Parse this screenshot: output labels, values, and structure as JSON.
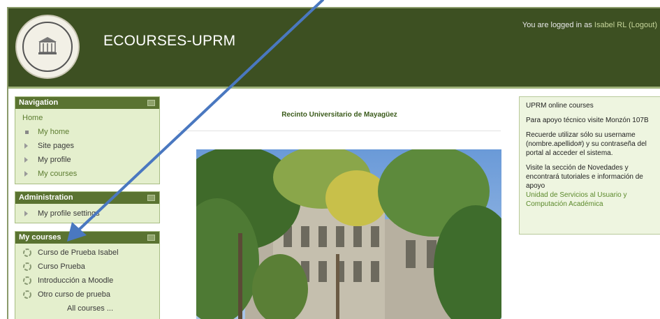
{
  "header": {
    "site_title": "ECOURSES-UPRM",
    "login_prefix": "You are logged in as",
    "user_name": "Isabel RL",
    "logout_label": "(Logout)"
  },
  "navigation": {
    "title": "Navigation",
    "home": "Home",
    "items": [
      "My home",
      "Site pages",
      "My profile",
      "My courses"
    ]
  },
  "administration": {
    "title": "Administration",
    "items": [
      "My profile settings"
    ]
  },
  "my_courses": {
    "title": "My courses",
    "courses": [
      "Curso de Prueba Isabel",
      "Curso Prueba",
      "Introducción a Moodle",
      "Otro curso de prueba"
    ],
    "all_courses": "All courses ..."
  },
  "center": {
    "title": "Recinto Universitario de Mayagüez"
  },
  "info_block": {
    "title": "UPRM online courses",
    "para1": "Para apoyo técnico visite Monzón 107B",
    "para2": "Recuerde utilizar sólo su username (nombre.apellido#) y su contraseña del portal al acceder el sistema.",
    "para3": "Visite la sección de Novedades y encontrará tutoriales e información de apoyo",
    "link": "Unidad de Servicios al Usuario y Computación Académica"
  },
  "colors": {
    "header_bg": "#3d5022",
    "block_header": "#5a7331",
    "block_bg": "#e4efcd",
    "arrow": "#4a78c0"
  },
  "icons": [
    "collapse-toggle-icon",
    "arrow-bullet-icon",
    "square-bullet-icon",
    "course-icon",
    "annotation-arrow"
  ]
}
